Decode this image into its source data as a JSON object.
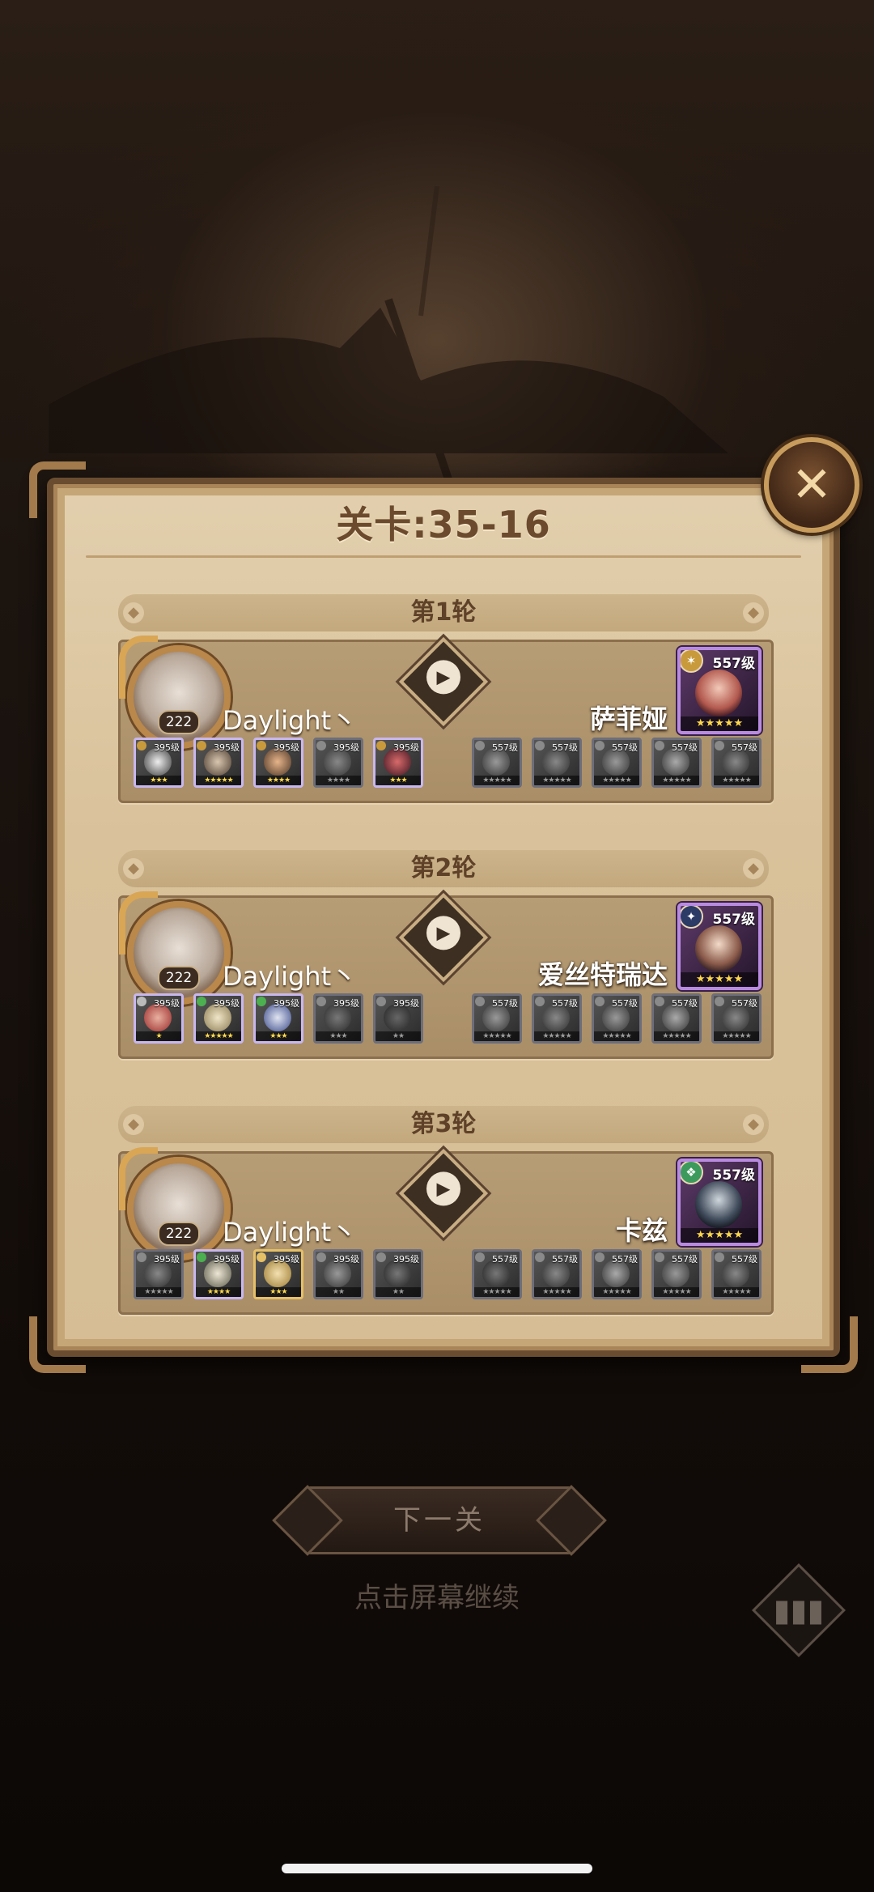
{
  "stage_title": "关卡:35-16",
  "rounds": [
    {
      "label": "第1轮",
      "player": {
        "level": "222",
        "name": "Daylight丶"
      },
      "enemy": {
        "name": "萨菲娅",
        "level": "557级",
        "stars": "★★★★★"
      },
      "player_units": [
        {
          "level": "395级",
          "stars": "★★★"
        },
        {
          "level": "395级",
          "stars": "★★★★★"
        },
        {
          "level": "395级",
          "stars": "★★★★"
        },
        {
          "level": "395级",
          "stars": "★★★★"
        },
        {
          "level": "395级",
          "stars": "★★★"
        }
      ],
      "enemy_units": [
        {
          "level": "557级",
          "stars": "★★★★★"
        },
        {
          "level": "557级",
          "stars": "★★★★★"
        },
        {
          "level": "557级",
          "stars": "★★★★★"
        },
        {
          "level": "557级",
          "stars": "★★★★★"
        },
        {
          "level": "557级",
          "stars": "★★★★★"
        }
      ]
    },
    {
      "label": "第2轮",
      "player": {
        "level": "222",
        "name": "Daylight丶"
      },
      "enemy": {
        "name": "爱丝特瑞达",
        "level": "557级",
        "stars": "★★★★★"
      },
      "player_units": [
        {
          "level": "395级",
          "stars": "★"
        },
        {
          "level": "395级",
          "stars": "★★★★★"
        },
        {
          "level": "395级",
          "stars": "★★★"
        },
        {
          "level": "395级",
          "stars": "★★★"
        },
        {
          "level": "395级",
          "stars": "★★"
        }
      ],
      "enemy_units": [
        {
          "level": "557级",
          "stars": "★★★★★"
        },
        {
          "level": "557级",
          "stars": "★★★★★"
        },
        {
          "level": "557级",
          "stars": "★★★★★"
        },
        {
          "level": "557级",
          "stars": "★★★★★"
        },
        {
          "level": "557级",
          "stars": "★★★★★"
        }
      ]
    },
    {
      "label": "第3轮",
      "player": {
        "level": "222",
        "name": "Daylight丶"
      },
      "enemy": {
        "name": "卡兹",
        "level": "557级",
        "stars": "★★★★★"
      },
      "player_units": [
        {
          "level": "395级",
          "stars": "★★★★★"
        },
        {
          "level": "395级",
          "stars": "★★★★"
        },
        {
          "level": "395级",
          "stars": "★★★"
        },
        {
          "level": "395级",
          "stars": "★★"
        },
        {
          "level": "395级",
          "stars": "★★"
        }
      ],
      "enemy_units": [
        {
          "level": "557级",
          "stars": "★★★★★"
        },
        {
          "level": "557级",
          "stars": "★★★★★"
        },
        {
          "level": "557级",
          "stars": "★★★★★"
        },
        {
          "level": "557级",
          "stars": "★★★★★"
        },
        {
          "level": "557级",
          "stars": "★★★★★"
        }
      ]
    }
  ],
  "next_button": "下一关",
  "tap_hint": "点击屏幕继续",
  "icons": {
    "close": "close-icon",
    "play": "play-icon",
    "stats": "bar-chart-icon",
    "faction": "faction-icon"
  },
  "colors": {
    "panel": "#d9c29b",
    "panel_border": "#6a4d30",
    "title": "#6b4a2d",
    "star": "#ffd84a",
    "boss_frame": "#b88be0"
  }
}
